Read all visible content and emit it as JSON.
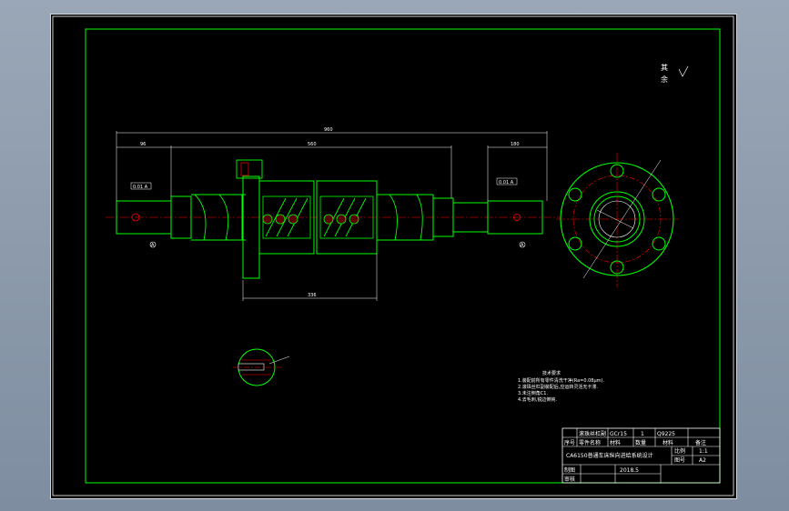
{
  "colors": {
    "background": "#000000",
    "frame": "#00ff00",
    "dimension": "#ffffff",
    "centerline": "#ff0000",
    "hatch": "#ff0000"
  },
  "roughness_note": {
    "label_1": "其",
    "label_2": "余"
  },
  "dimensions": {
    "overall": "960",
    "left_span": "96",
    "mid_span": "560",
    "right_span": "180",
    "bottom_span": "336"
  },
  "tolerance_frames": {
    "left": "0.01 A",
    "right": "0.01 A"
  },
  "datum_label": "A",
  "tech_requirements": {
    "title": "技术要求",
    "items": [
      "1.装配前所有零件清洗干净(Ra=0.08μm).",
      "2.滚珠丝杠副装配后,应运转灵活无卡滞.",
      "3.未注倒角C1.",
      "4.去毛刺,锐边倒钝."
    ]
  },
  "title_block": {
    "r1": [
      "滚珠丝杠副",
      "GCr15",
      "1",
      "Q9225"
    ],
    "r2": [
      "序号",
      "零件名称",
      "材料",
      "数量",
      "材料",
      "备注"
    ],
    "drawing_title": "CA6150普通车床纵向进给系统设计",
    "scale_label": "比例",
    "scale_value": "1:1",
    "sheet_label": "图号",
    "sheet_value": "A2",
    "drawn_label": "制图",
    "drawn_date": "2018.5",
    "check_label": "审核"
  }
}
